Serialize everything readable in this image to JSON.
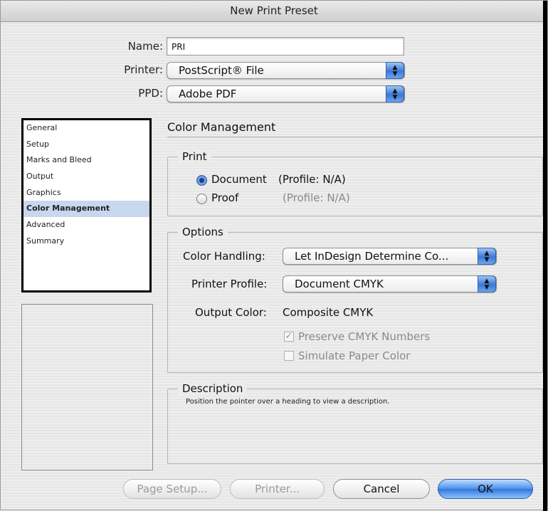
{
  "window": {
    "title": "New Print Preset"
  },
  "fields": {
    "name_label": "Name:",
    "name_value": "PRI",
    "printer_label": "Printer:",
    "printer_value": "PostScript® File",
    "ppd_label": "PPD:",
    "ppd_value": "Adobe PDF"
  },
  "sidebar": {
    "items": [
      {
        "label": "General"
      },
      {
        "label": "Setup"
      },
      {
        "label": "Marks and Bleed"
      },
      {
        "label": "Output"
      },
      {
        "label": "Graphics"
      },
      {
        "label": "Color Management",
        "selected": true
      },
      {
        "label": "Advanced"
      },
      {
        "label": "Summary"
      }
    ]
  },
  "panel": {
    "title": "Color Management",
    "print_group": {
      "title": "Print",
      "document_label": "Document",
      "document_profile": "(Profile: N/A)",
      "document_selected": true,
      "proof_label": "Proof",
      "proof_profile": "(Profile: N/A)"
    },
    "options_group": {
      "title": "Options",
      "color_handling_label": "Color Handling:",
      "color_handling_value": "Let InDesign Determine Co...",
      "printer_profile_label": "Printer Profile:",
      "printer_profile_value": "Document CMYK",
      "output_color_label": "Output Color:",
      "output_color_value": "Composite CMYK",
      "preserve_cmyk_label": "Preserve CMYK Numbers",
      "preserve_cmyk_checked": true,
      "simulate_paper_label": "Simulate Paper Color",
      "simulate_paper_checked": false
    },
    "description_group": {
      "title": "Description",
      "text": "Position the pointer over a heading to view a description."
    }
  },
  "buttons": {
    "page_setup": "Page Setup...",
    "printer": "Printer...",
    "cancel": "Cancel",
    "ok": "OK"
  },
  "icons": {
    "popup_arrows": "up-down-arrows-icon",
    "radio_selected": "radio-selected-icon",
    "checkmark": "checkmark-icon"
  }
}
